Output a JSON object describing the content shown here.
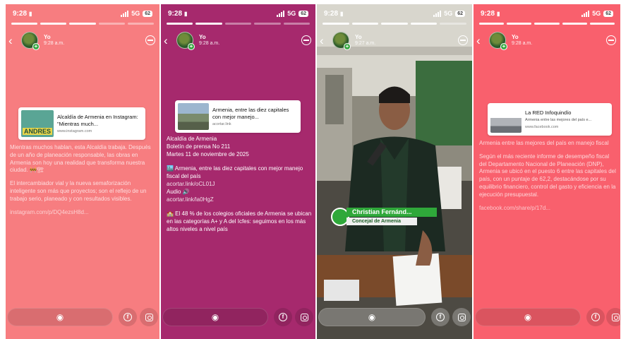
{
  "colors": {
    "story1_bg": "#f77d80",
    "story2_bg": "#a6296d",
    "story4_bg": "#f9606d",
    "name_tag": "#2fa83a"
  },
  "stories": [
    {
      "status": {
        "time": "9:28",
        "network": "5G",
        "battery": "62"
      },
      "account": {
        "name": "Yo",
        "time": "9:28 a.m."
      },
      "card": {
        "title": "Alcaldía de Armenia en Instagram: \"Mientras much...",
        "url": "www.instagram.com",
        "thumb_text": "ANDRES"
      },
      "paragraphs": [
        "Mientras muchos hablan, esta Alcaldía trabaja. Después de un año de planeación responsable, las obras en Armenia son hoy una realidad que transforma nuestra ciudad. 🚧🏗",
        "El intercambiador vial y la nueva semaforización inteligente son más que proyectos; son el reflejo de un trabajo serio, planeado y con resultados visibles."
      ],
      "link": "instagram.com/p/DQ4ezsH8d..."
    },
    {
      "status": {
        "time": "9:28",
        "network": "5G",
        "battery": "62"
      },
      "account": {
        "name": "Yo",
        "time": "9:28 a.m."
      },
      "card": {
        "title": "Armenia, entre las diez capitales con mejor manejo...",
        "url": "acortar.link"
      },
      "lines": [
        "Alcaldía de Armenia",
        "Boletín de prensa No 211",
        "Martes  11 de noviembre de 2025"
      ],
      "item1": "🏙️ Armenia, entre las diez capitales con mejor manejo fiscal del país",
      "link1": "acortar.link/oCL01J",
      "audio": "Audio 🔊",
      "link2": "acortar.link/la0HgZ",
      "item2": "🏫 El 48 % de los colegios oficiales de Armenia se ubican en las categorías A+ y A del Icfes: seguimos en los más altos niveles a nivel país"
    },
    {
      "status": {
        "time": "9:28",
        "network": "5G",
        "battery": "62"
      },
      "account": {
        "name": "Yo",
        "time": "9:27 a.m."
      },
      "name_tag": {
        "name": "Christian Fernánd...",
        "role": "Concejal de Armenia"
      }
    },
    {
      "status": {
        "time": "9:28",
        "network": "5G",
        "battery": "62"
      },
      "account": {
        "name": "Yo",
        "time": "9:28 a.m."
      },
      "card": {
        "title": "La RED Infoquindío",
        "desc": "Armenia entre las mejores del país e...",
        "url": "www.facebook.com"
      },
      "headline": "Armenia entre las mejores del país en manejo fiscal",
      "paragraph": "Según el más reciente informe de desempeño fiscal del Departamento Nacional de Planeación (DNP), Armenia se ubicó en el puesto 6 entre las capitales del país, con un puntaje de 62,2, destacándose por su equilibrio financiero, control del gasto y eficiencia en la ejecución presupuestal.",
      "link": "facebook.com/share/p/17d..."
    }
  ]
}
